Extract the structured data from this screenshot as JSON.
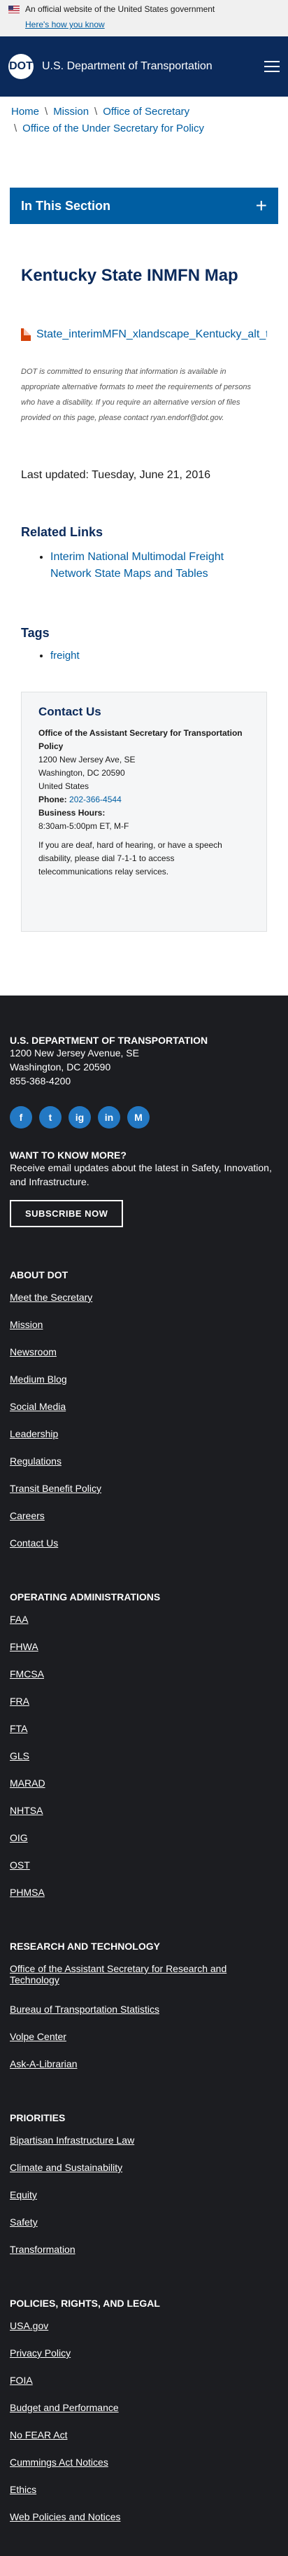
{
  "banner": {
    "text": "An official website of the United States government",
    "how_link": "Here's how you know"
  },
  "header": {
    "logo_text": "DOT",
    "site_name": "U.S. Department of Transportation"
  },
  "breadcrumb": {
    "items": [
      "Home",
      "Mission",
      "Office of Secretary",
      "Office of the Under Secretary for Policy"
    ]
  },
  "section_nav": {
    "label": "In This Section"
  },
  "page": {
    "title": "Kentucky State INMFN Map",
    "file_link": "State_interimMFN_xlandscape_Kentucky_alt_text.pdf",
    "notice": "DOT is committed to ensuring that information is available in appropriate alternative formats to meet the requirements of persons who have a disability. If you require an alternative version of files provided on this page, please contact ryan.endorf@dot.gov.",
    "last_updated": "Last updated: Tuesday, June 21, 2016"
  },
  "related": {
    "heading": "Related Links",
    "items": [
      "Interim National Multimodal Freight Network State Maps and Tables"
    ]
  },
  "tags": {
    "heading": "Tags",
    "items": [
      "freight"
    ]
  },
  "contact": {
    "heading": "Contact Us",
    "office": "Office of the Assistant Secretary for Transportation Policy",
    "addr1": "1200 New Jersey Ave, SE",
    "addr2": "Washington, DC 20590",
    "addr3": "United States",
    "phone_label": "Phone:",
    "phone": "202-366-4544",
    "hours_label": "Business Hours:",
    "hours": "8:30am-5:00pm ET, M-F",
    "relay": "If you are deaf, hard of hearing, or have a speech disability, please dial 7-1-1 to access telecommunications relay services."
  },
  "footer": {
    "org": "U.S. DEPARTMENT OF TRANSPORTATION",
    "addr1": "1200 New Jersey Avenue, SE",
    "addr2": "Washington, DC 20590",
    "phone": "855-368-4200",
    "social": [
      "f",
      "t",
      "ig",
      "in",
      "M"
    ],
    "want_heading": "WANT TO KNOW MORE?",
    "want_text": "Receive email updates about the latest in Safety, Innovation, and Infrastructure.",
    "subscribe": "SUBSCRIBE NOW",
    "about_heading": "ABOUT DOT",
    "about": [
      "Meet the Secretary",
      "Mission",
      "Newsroom",
      "Medium Blog",
      "Social Media",
      "Leadership",
      "Regulations",
      "Transit Benefit Policy",
      "Careers",
      "Contact Us"
    ],
    "ops_heading": "OPERATING ADMINISTRATIONS",
    "ops": [
      "FAA",
      "FHWA",
      "FMCSA",
      "FRA",
      "FTA",
      "GLS",
      "MARAD",
      "NHTSA",
      "OIG",
      "OST",
      "PHMSA"
    ],
    "research_heading": "RESEARCH AND TECHNOLOGY",
    "research": [
      "Office of the Assistant Secretary for Research and Technology",
      "Bureau of Transportation Statistics",
      "Volpe Center",
      "Ask-A-Librarian"
    ],
    "priorities_heading": "PRIORITIES",
    "priorities": [
      "Bipartisan Infrastructure Law",
      "Climate and Sustainability",
      "Equity",
      "Safety",
      "Transformation"
    ],
    "policies_heading": "POLICIES, RIGHTS, AND LEGAL",
    "policies": [
      "USA.gov",
      "Privacy Policy",
      "FOIA",
      "Budget and Performance",
      "No FEAR Act",
      "Cummings Act Notices",
      "Ethics",
      "Web Policies and Notices"
    ]
  }
}
